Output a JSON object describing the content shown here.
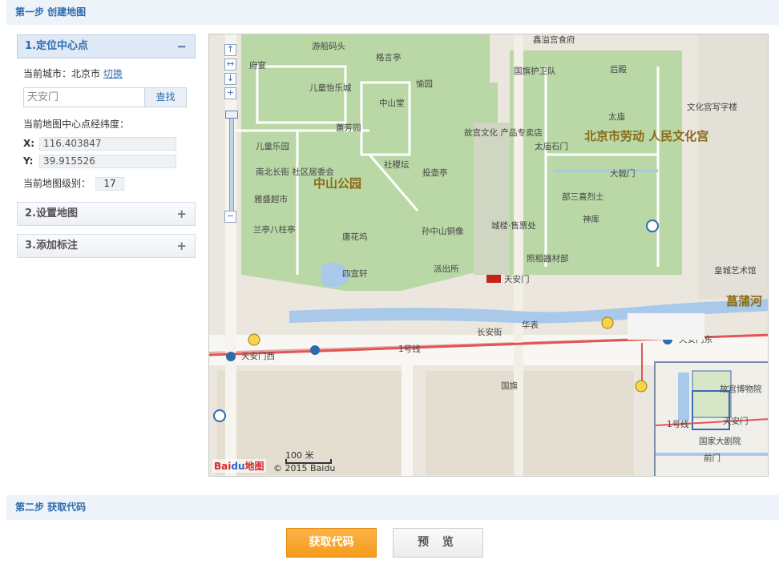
{
  "steps": {
    "step1_title": "第一步 创建地图",
    "step2_title": "第二步 获取代码"
  },
  "panel": {
    "locate": {
      "title": "1.定位中心点",
      "toggle": "−",
      "city_label": "当前城市：",
      "city_value": "北京市",
      "switch_link": "切换",
      "search_value": "天安门",
      "search_button": "查找",
      "center_label": "当前地图中心点经纬度：",
      "x_label": "X:",
      "x_value": "116.403847",
      "y_label": "Y:",
      "y_value": "39.915526",
      "zoom_label": "当前地图级别：",
      "zoom_value": "17"
    },
    "settings": {
      "title": "2.设置地图",
      "toggle": "+"
    },
    "markers": {
      "title": "3.添加标注",
      "toggle": "+"
    }
  },
  "map": {
    "labels": {
      "youchuan": "游船码头",
      "geyan": "格言亭",
      "xinyi": "鑫溢宫食府",
      "fuyan": "府宴",
      "guoqi_guard": "国旗护卫队",
      "houge": "后殿",
      "children_city": "儿童怡乐城",
      "yuyuan": "愉园",
      "zhongshantang": "中山堂",
      "taimiao": "太庙",
      "culture_building": "文化宫写字楼",
      "huifang": "蕙芳园",
      "gugong_shop": "故宫文化\n产品专卖店",
      "laodong_palace": "北京市劳动\n人民文化宫",
      "children_park": "儿童乐园",
      "taimiao_stone": "太庙石门",
      "sheji": "社稷坛",
      "nanchang": "南北长街\n社区居委会",
      "zhongshan_park": "中山公园",
      "tou_di": "投壶亭",
      "dajidian": "大戟门",
      "yasheng": "雅盛超市",
      "sansan": "部三喜烈士",
      "lanni": "兰亭八柱亭",
      "tanghua": "唐花坞",
      "sun_statue": "孙中山铜像",
      "chenglou": "城楼·售票处",
      "shenku": "神库",
      "sigui": "四宜轩",
      "paichusuo": "派出所",
      "zhaoxiang": "照相器材部",
      "huangcheng_gallery": "皇城艺术馆",
      "tiananmen": "天安门",
      "changpu": "菖蒲河",
      "changan": "长安街",
      "huabiao": "华表",
      "tiananmen_west": "天安门西",
      "tiananmen_east": "天安门东",
      "line1": "1号线",
      "guoqi": "国旗"
    },
    "overview": {
      "palace": "故宫博物院",
      "tiananmen": "天安门",
      "theatre": "国家大剧院",
      "line1": "1号线",
      "qianmen": "前门"
    },
    "scale_label": "100 米",
    "logo_bai": "Bai",
    "logo_du": "du",
    "logo_text": "地图",
    "copyright": "© 2015 Baidu"
  },
  "actions": {
    "get_code": "获取代码",
    "preview": "预 览"
  }
}
